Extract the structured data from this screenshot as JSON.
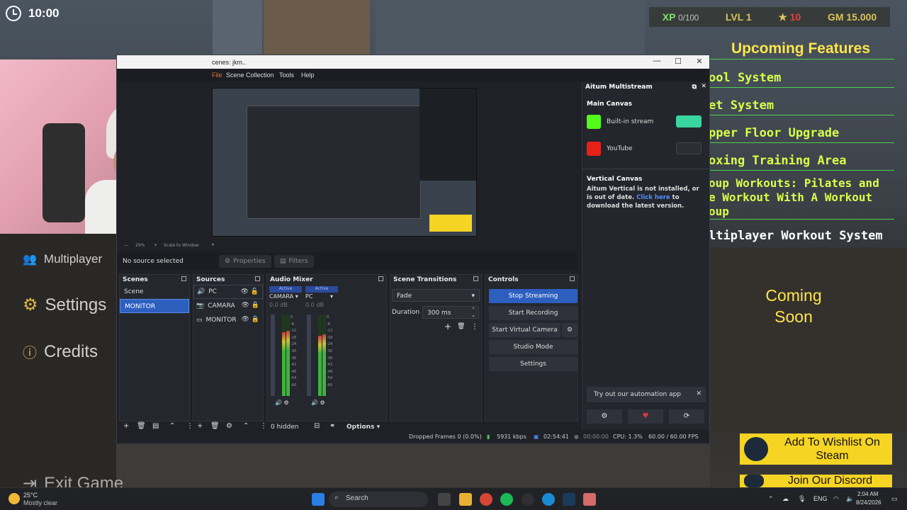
{
  "game": {
    "timer": "10:00",
    "hud": {
      "xp_label": "XP",
      "xp_value": "0/100",
      "level": "LVL 1",
      "star_count": "10",
      "gm": "GM 15.000"
    },
    "upcoming_title": "Upcoming Features",
    "features": [
      "ool System",
      "et System",
      "pper Floor Upgrade",
      "oxing Training Area",
      "oup Workouts: Pilates and",
      "e Workout With A Workout",
      "oup",
      "ltiplayer Workout System"
    ],
    "coming_soon": [
      "Coming",
      "Soon"
    ],
    "left_menu": [
      "Multiplayer",
      "Settings",
      "Credits",
      "Exit Game"
    ],
    "wishlist": "Add To Wishlist On Steam",
    "discord": "Join Our Discord"
  },
  "obs": {
    "title": "cenes: jkm..",
    "menu": [
      "File",
      "Scene Collection",
      "Tools",
      "Help"
    ],
    "scale": {
      "zoom": "29%",
      "label": "Scale to Window"
    },
    "no_source": "No source selected",
    "properties": "Properties",
    "filters": "Filters",
    "scenes": {
      "title": "Scenes",
      "items": [
        "Scene",
        "MONITOR"
      ]
    },
    "sources": {
      "title": "Sources",
      "items": [
        "PC",
        "CAMARA",
        "MONITOR"
      ]
    },
    "mixer": {
      "title": "Audio Mixer",
      "channels": [
        {
          "name": "CAMARA",
          "badge": "Active",
          "db": "0.0 dB"
        },
        {
          "name": "PC",
          "badge": "Active",
          "db": "0.0 dB"
        }
      ],
      "scale": [
        "0",
        "-6",
        "-12",
        "-18",
        "-24",
        "-30",
        "-36",
        "-42",
        "-48",
        "-54",
        "-60"
      ],
      "hidden": "0 hidden",
      "options": "Options"
    },
    "transitions": {
      "title": "Scene Transitions",
      "type": "Fade",
      "duration_label": "Duration",
      "duration": "300 ms"
    },
    "controls": {
      "title": "Controls",
      "buttons": [
        "Stop Streaming",
        "Start Recording",
        "Start Virtual Camera",
        "Studio Mode",
        "Settings"
      ]
    },
    "status": {
      "dropped": "Dropped Frames 0 (0.0%)",
      "kbps": "5931 kbps",
      "live": "02:54:41",
      "rec": "00:00:00",
      "cpu": "CPU: 1.3%",
      "fps": "60.00 / 60.00 FPS"
    },
    "multistream": {
      "title": "Aitum Multistream",
      "main_canvas": "Main Canvas",
      "outputs": [
        "Built-in stream",
        "YouTube"
      ],
      "vertical_canvas": "Vertical Canvas",
      "note": "Aitum Vertical is not installed, or is out of date.",
      "link": "Click here",
      "note2": "to download the latest version.",
      "automation": "Try out our automation app"
    }
  },
  "taskbar": {
    "weather_temp": "25°C",
    "weather_desc": "Mostly clear",
    "search": "Search",
    "lang": "ENG",
    "time": "2:04 AM",
    "date": "8/24/2026"
  },
  "colors": {
    "obs_blue": "#2d5fbf",
    "game_yellow": "#ffe54a",
    "game_green": "#d8ff4a"
  }
}
